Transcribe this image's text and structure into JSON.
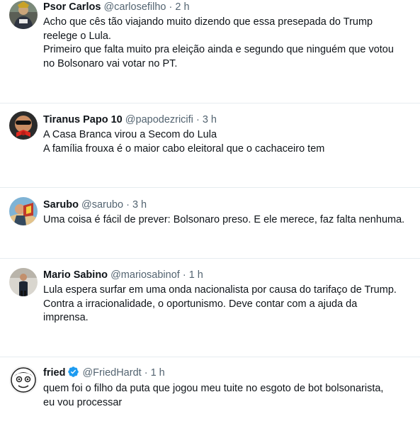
{
  "tweets": [
    {
      "name": "Psor Carlos",
      "handle": "@carlosefilho",
      "separator": "·",
      "time": "2 h",
      "lines": [
        "Acho que cês tão viajando muito dizendo que essa presepada do Trump",
        "reelege o Lula.",
        "Primeiro que falta muito pra eleição ainda e segundo que ninguém que votou",
        "no Bolsonaro vai votar no PT."
      ]
    },
    {
      "name": "Tiranus Papo 10",
      "handle": "@papodezricifi",
      "separator": "·",
      "time": "3 h",
      "lines": [
        "A Casa Branca virou a Secom do Lula",
        "A família frouxa é o maior cabo eleitoral que o cachaceiro tem"
      ]
    },
    {
      "name": "Sarubo",
      "handle": "@sarubo",
      "separator": "·",
      "time": "3 h",
      "lines": [
        "Uma coisa é fácil de prever: Bolsonaro preso. E ele merece, faz falta nenhuma."
      ]
    },
    {
      "name": "Mario Sabino",
      "handle": "@mariosabinof",
      "separator": "·",
      "time": "1 h",
      "lines": [
        "Lula espera surfar em uma onda nacionalista por causa do tarifaço de Trump.",
        "Contra a irracionalidade, o oportunismo. Deve contar com a ajuda da",
        "imprensa."
      ]
    },
    {
      "name": "fried",
      "handle": "@FriedHardt",
      "separator": "·",
      "time": "1 h",
      "verified": true,
      "lines": [
        "quem foi o filho da puta que jogou meu tuite no esgoto de bot bolsonarista,",
        "eu vou processar"
      ]
    }
  ],
  "colors": {
    "text": "#0f1419",
    "secondary": "#536471",
    "divider": "#e6ecf0",
    "verified": "#1d9bf0"
  },
  "icons": {
    "verified": "verified-badge-icon",
    "avatars": [
      "avatar-psor-carlos",
      "avatar-tiranus",
      "avatar-sarubo",
      "avatar-mario-sabino",
      "avatar-fried"
    ]
  }
}
